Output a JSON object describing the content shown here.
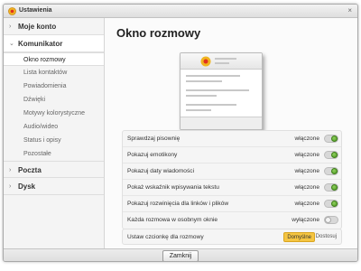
{
  "window": {
    "title": "Ustawienia",
    "close_glyph": "×",
    "app_icon": "gear-sun-icon"
  },
  "sidebar": {
    "categories": [
      {
        "label": "Moje konto",
        "arrow": "›"
      },
      {
        "label": "Komunikator",
        "arrow": "⌄"
      },
      {
        "label": "Poczta",
        "arrow": "›"
      },
      {
        "label": "Dysk",
        "arrow": "›"
      }
    ],
    "subitems": [
      "Okno rozmowy",
      "Lista kontaktów",
      "Powiadomienia",
      "Dźwięki",
      "Motywy kolorystyczne",
      "Audio/wideo",
      "Status i opisy",
      "Pozostałe"
    ],
    "active_subitem": "Okno rozmowy"
  },
  "main": {
    "title": "Okno rozmowy",
    "settings": [
      {
        "label": "Sprawdzaj pisownię",
        "state": "włączone",
        "on": true
      },
      {
        "label": "Pokazuj emotikony",
        "state": "włączone",
        "on": true
      },
      {
        "label": "Pokazuj daty wiadomości",
        "state": "włączone",
        "on": true
      },
      {
        "label": "Pokaż wskaźnik wpisywania tekstu",
        "state": "włączone",
        "on": true
      },
      {
        "label": "Pokazuj rozwinięcia dla linków i plików",
        "state": "włączone",
        "on": true
      },
      {
        "label": "Każda rozmowa w osobnym oknie",
        "state": "wyłączone",
        "on": false
      }
    ],
    "font": {
      "label": "Ustaw czcionkę dla rozmowy",
      "default_label": "Domyślne",
      "custom_label": "Dostosuj"
    }
  },
  "footer": {
    "close_label": "Zamknij"
  },
  "colors": {
    "toggle_on": "#4e9a22",
    "segment_active": "#f5c542",
    "sun_icon": "#f0b420"
  }
}
